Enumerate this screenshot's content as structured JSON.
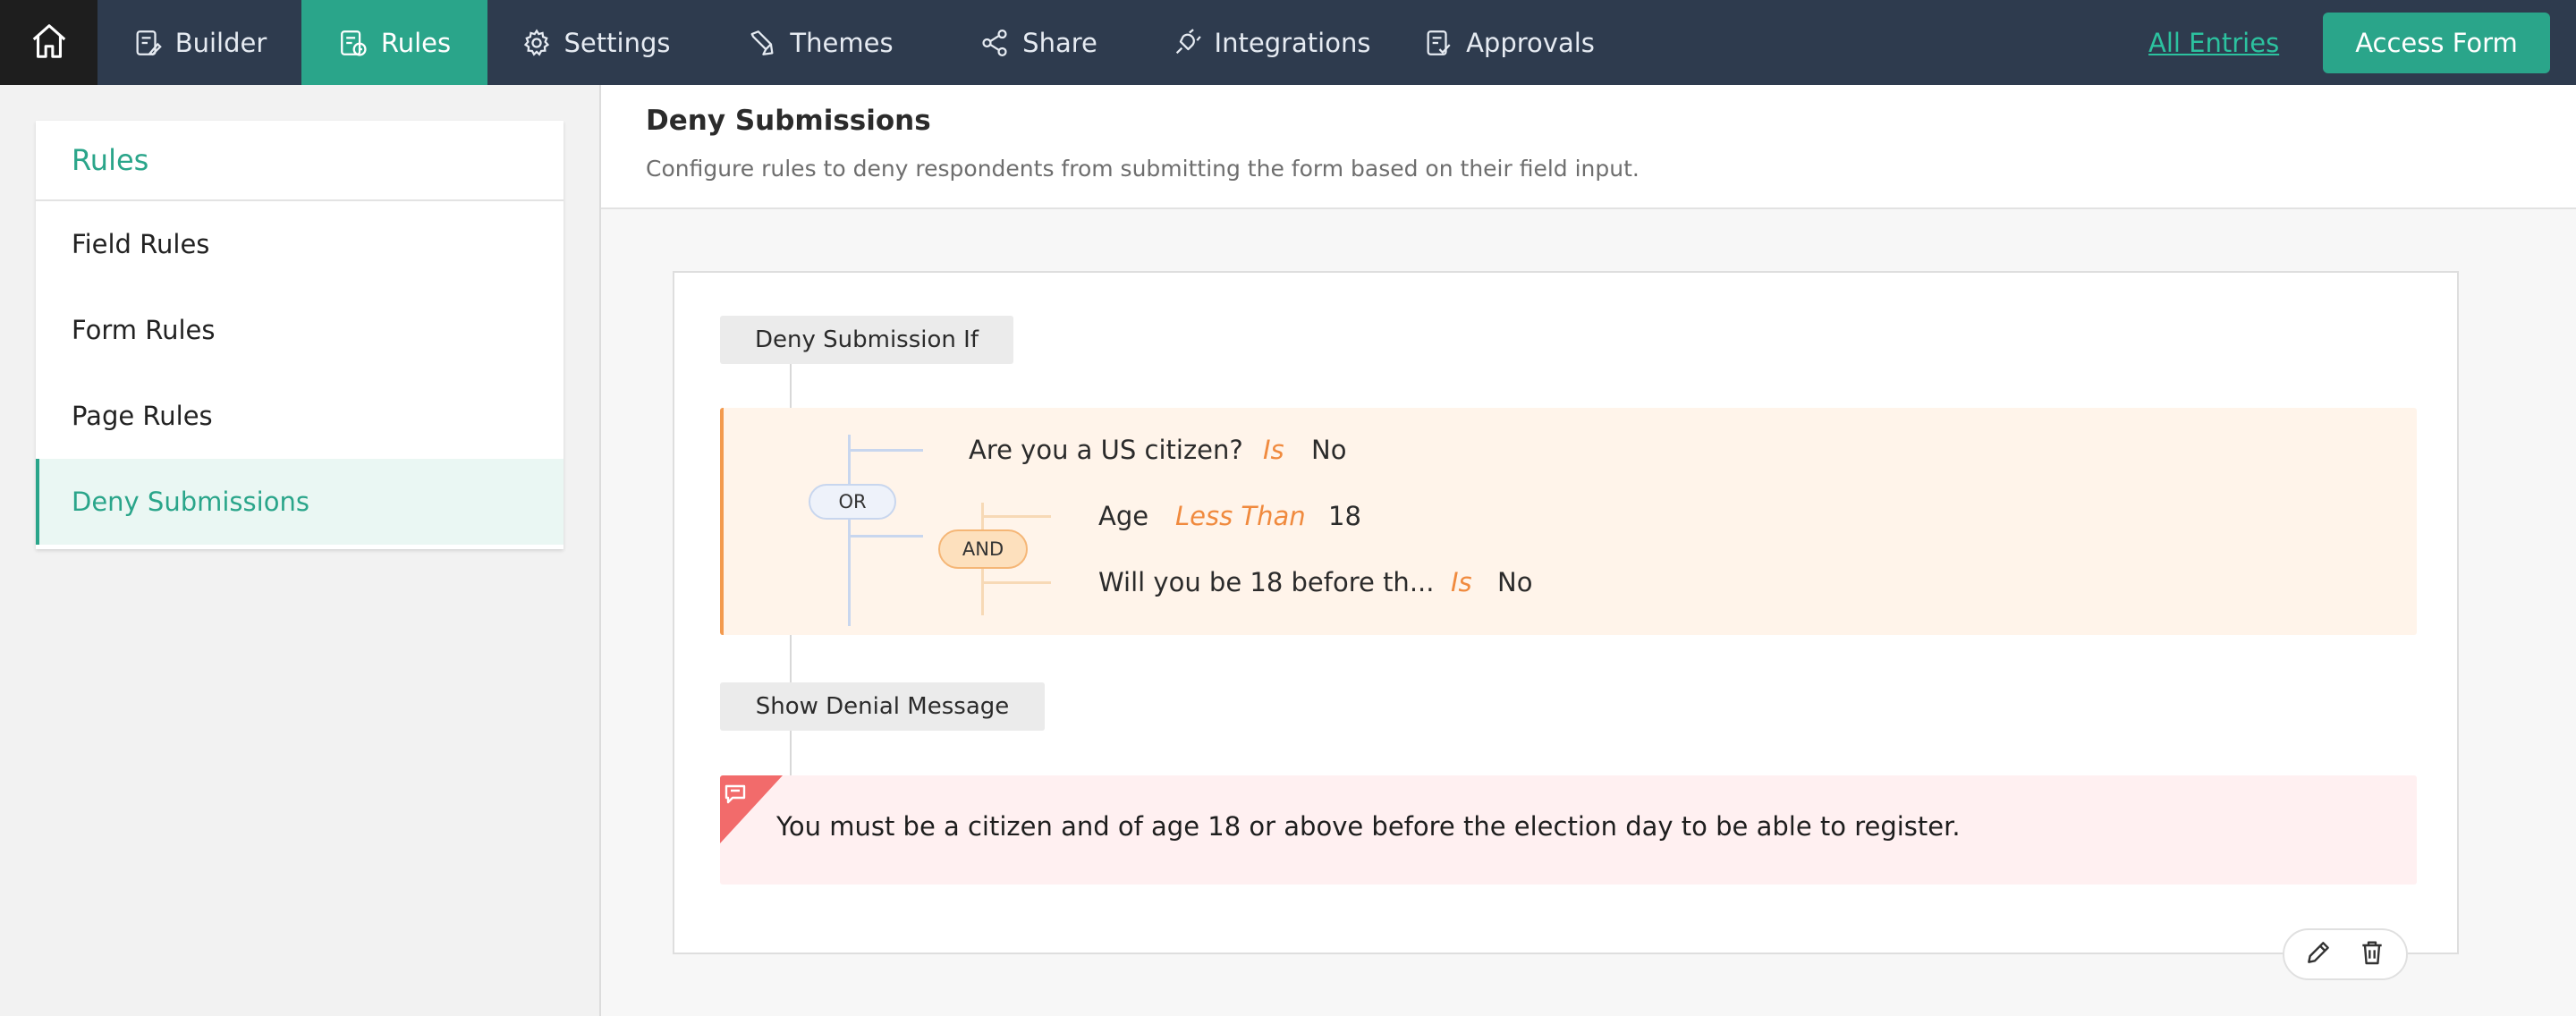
{
  "nav": {
    "items": [
      {
        "label": "Builder",
        "icon": "builder-icon"
      },
      {
        "label": "Rules",
        "icon": "rules-icon",
        "active": true
      },
      {
        "label": "Settings",
        "icon": "gear-icon"
      },
      {
        "label": "Themes",
        "icon": "brush-icon"
      },
      {
        "label": "Share",
        "icon": "share-icon"
      },
      {
        "label": "Integrations",
        "icon": "plug-icon"
      },
      {
        "label": "Approvals",
        "icon": "approvals-icon"
      }
    ],
    "all_entries": "All Entries",
    "access_form": "Access Form"
  },
  "sidebar": {
    "title": "Rules",
    "items": [
      {
        "label": "Field Rules"
      },
      {
        "label": "Form Rules"
      },
      {
        "label": "Page Rules"
      },
      {
        "label": "Deny Submissions",
        "active": true
      }
    ]
  },
  "main": {
    "title": "Deny Submissions",
    "description": "Configure rules to deny respondents from submitting the form based on their field input."
  },
  "rule": {
    "condition_label": "Deny Submission If",
    "or_label": "OR",
    "and_label": "AND",
    "conditions": [
      {
        "field": "Are you a US citizen?",
        "operator": "Is",
        "value": "No"
      },
      {
        "field": "Age",
        "operator": "Less Than",
        "value": "18"
      },
      {
        "field": "Will you be 18 before th...",
        "operator": "Is",
        "value": "No"
      }
    ],
    "action_label": "Show Denial Message",
    "message": "You must be a citizen and of age 18 or above before the election day to be able to register."
  },
  "colors": {
    "topbar": "#2e3b4e",
    "accent": "#2aa58a",
    "operator": "#f08a3e",
    "message_corner": "#f26b6b"
  }
}
